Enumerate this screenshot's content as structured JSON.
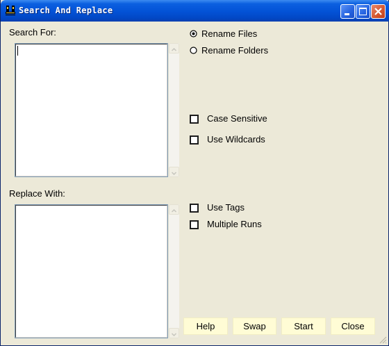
{
  "window": {
    "title": "Search And Replace",
    "minimize_label": "Minimize",
    "maximize_label": "Maximize",
    "close_label": "Close window"
  },
  "search": {
    "label": "Search For:",
    "value": ""
  },
  "replace": {
    "label": "Replace With:",
    "value": ""
  },
  "mode": {
    "options": [
      {
        "label": "Rename Files",
        "selected": true
      },
      {
        "label": "Rename Folders",
        "selected": false
      }
    ]
  },
  "options": {
    "case_sensitive": {
      "label": "Case Sensitive",
      "checked": false
    },
    "use_wildcards": {
      "label": "Use Wildcards",
      "checked": false
    },
    "use_tags": {
      "label": "Use Tags",
      "checked": false
    },
    "multiple_runs": {
      "label": "Multiple Runs",
      "checked": false
    }
  },
  "buttons": {
    "help": "Help",
    "swap": "Swap",
    "start": "Start",
    "close": "Close"
  },
  "colors": {
    "window_bg": "#ece9d8",
    "titlebar": "#0352d6",
    "button_bg": "#fffcd5"
  }
}
